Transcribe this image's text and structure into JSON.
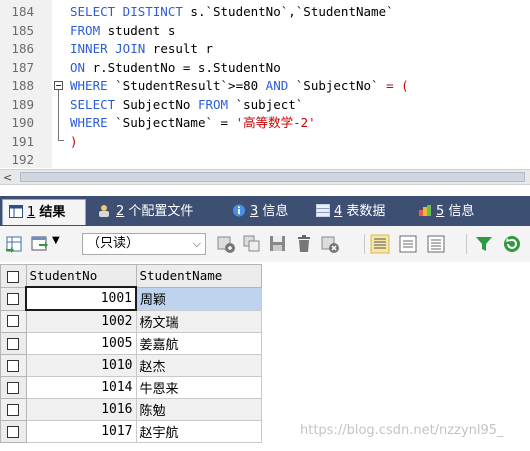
{
  "editor": {
    "lines": [
      {
        "no": "184",
        "tokens": [
          [
            "kw",
            "SELECT DISTINCT "
          ],
          [
            "id",
            "s.`StudentNo`,`StudentName`"
          ]
        ]
      },
      {
        "no": "185",
        "tokens": [
          [
            "kw",
            "FROM "
          ],
          [
            "id",
            "student s"
          ]
        ]
      },
      {
        "no": "186",
        "tokens": [
          [
            "kw",
            "INNER JOIN "
          ],
          [
            "id",
            "result r"
          ]
        ]
      },
      {
        "no": "187",
        "tokens": [
          [
            "kw",
            "ON "
          ],
          [
            "id",
            "r.StudentNo = s.StudentNo"
          ]
        ]
      },
      {
        "no": "188",
        "tokens": [
          [
            "kw",
            "WHERE "
          ],
          [
            "id",
            "`StudentResult`>=80 "
          ],
          [
            "kw",
            "AND "
          ],
          [
            "id",
            "`SubjectNo` "
          ],
          [
            "str",
            "= ("
          ]
        ]
      },
      {
        "no": "189",
        "tokens": [
          [
            "kw",
            "SELECT "
          ],
          [
            "id",
            "SubjectNo "
          ],
          [
            "kw",
            "FROM "
          ],
          [
            "id",
            "`subject`"
          ]
        ]
      },
      {
        "no": "190",
        "tokens": [
          [
            "kw",
            "WHERE "
          ],
          [
            "id",
            "`SubjectName` = "
          ],
          [
            "str",
            "'高等数学-2'"
          ]
        ]
      },
      {
        "no": "191",
        "tokens": [
          [
            "str",
            ")"
          ]
        ]
      },
      {
        "no": "192",
        "tokens": []
      }
    ],
    "scroll_left_arrow": "<"
  },
  "tabs": [
    {
      "num": "1",
      "label": "结果",
      "active": true,
      "icon": "result-grid-icon"
    },
    {
      "num": "2",
      "label": "个配置文件",
      "active": false,
      "icon": "profile-icon"
    },
    {
      "num": "3",
      "label": "信息",
      "active": false,
      "icon": "info-icon"
    },
    {
      "num": "4",
      "label": "表数据",
      "active": false,
      "icon": "table-data-icon"
    },
    {
      "num": "5",
      "label": "信息",
      "active": false,
      "icon": "info-history-icon"
    }
  ],
  "toolbar": {
    "mode_select": "（只读）"
  },
  "grid": {
    "columns": [
      "StudentNo",
      "StudentName"
    ],
    "rows": [
      [
        "1001",
        "周颖"
      ],
      [
        "1002",
        "杨文瑞"
      ],
      [
        "1005",
        "姜嘉航"
      ],
      [
        "1010",
        "赵杰"
      ],
      [
        "1014",
        "牛恩来"
      ],
      [
        "1016",
        "陈勉"
      ],
      [
        "1017",
        "赵宇航"
      ]
    ]
  },
  "watermark": "https://blog.csdn.net/nzzynl95_",
  "colors": {
    "keyword": "#2d5dd7",
    "string": "#cc0000",
    "tabbar": "#3d4f73",
    "selected_cell": "#bdd3ee"
  }
}
